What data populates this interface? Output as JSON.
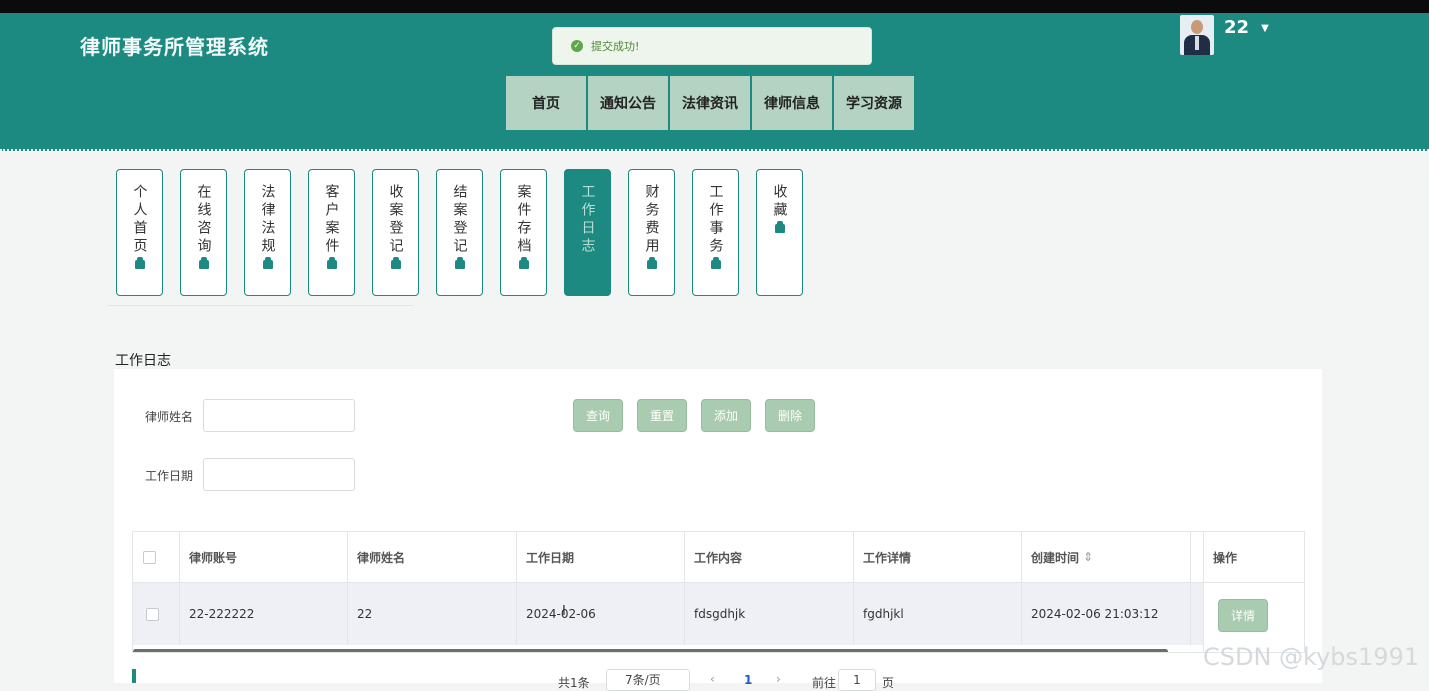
{
  "app": {
    "title": "律师事务所管理系统"
  },
  "toast": {
    "message": "提交成功!"
  },
  "top_nav": [
    {
      "label": "首页"
    },
    {
      "label": "通知公告"
    },
    {
      "label": "法律资讯"
    },
    {
      "label": "律师信息"
    },
    {
      "label": "学习资源"
    }
  ],
  "user": {
    "name": "22"
  },
  "side_menu": [
    {
      "label": "个人首页",
      "active": false
    },
    {
      "label": "在线咨询",
      "active": false
    },
    {
      "label": "法律法规",
      "active": false
    },
    {
      "label": "客户案件",
      "active": false
    },
    {
      "label": "收案登记",
      "active": false
    },
    {
      "label": "结案登记",
      "active": false
    },
    {
      "label": "案件存档",
      "active": false
    },
    {
      "label": "工作日志",
      "active": true
    },
    {
      "label": "财务费用",
      "active": false
    },
    {
      "label": "工作事务",
      "active": false
    },
    {
      "label": "收藏",
      "active": false
    }
  ],
  "page": {
    "title": "工作日志"
  },
  "filters": {
    "name_label": "律师姓名",
    "name_value": "",
    "date_label": "工作日期",
    "date_value": ""
  },
  "buttons": {
    "query": "查询",
    "reset": "重置",
    "add": "添加",
    "delete": "删除",
    "detail": "详情"
  },
  "table": {
    "columns": [
      "律师账号",
      "律师姓名",
      "工作日期",
      "工作内容",
      "工作详情",
      "创建时间",
      "操作"
    ],
    "sort_indicator": "⇕",
    "rows": [
      {
        "account": "22-222222",
        "name": "22",
        "date": "2024-02-06",
        "content": "fdsgdhjk",
        "detail": "fgdhjkl",
        "created": "2024-02-06 21:03:12"
      }
    ]
  },
  "pagination": {
    "total": "共1条",
    "page_size": "7条/页",
    "current_page": "1",
    "goto_label": "前往",
    "goto_value": "1",
    "page_unit": "页"
  },
  "watermark": {
    "text": "CSDN @kybs1991"
  },
  "colors": {
    "primary": "#1c8a80",
    "nav_button": "#b5d3c2",
    "action_button": "#a9cbb0",
    "toast_bg": "#eef5ec"
  }
}
